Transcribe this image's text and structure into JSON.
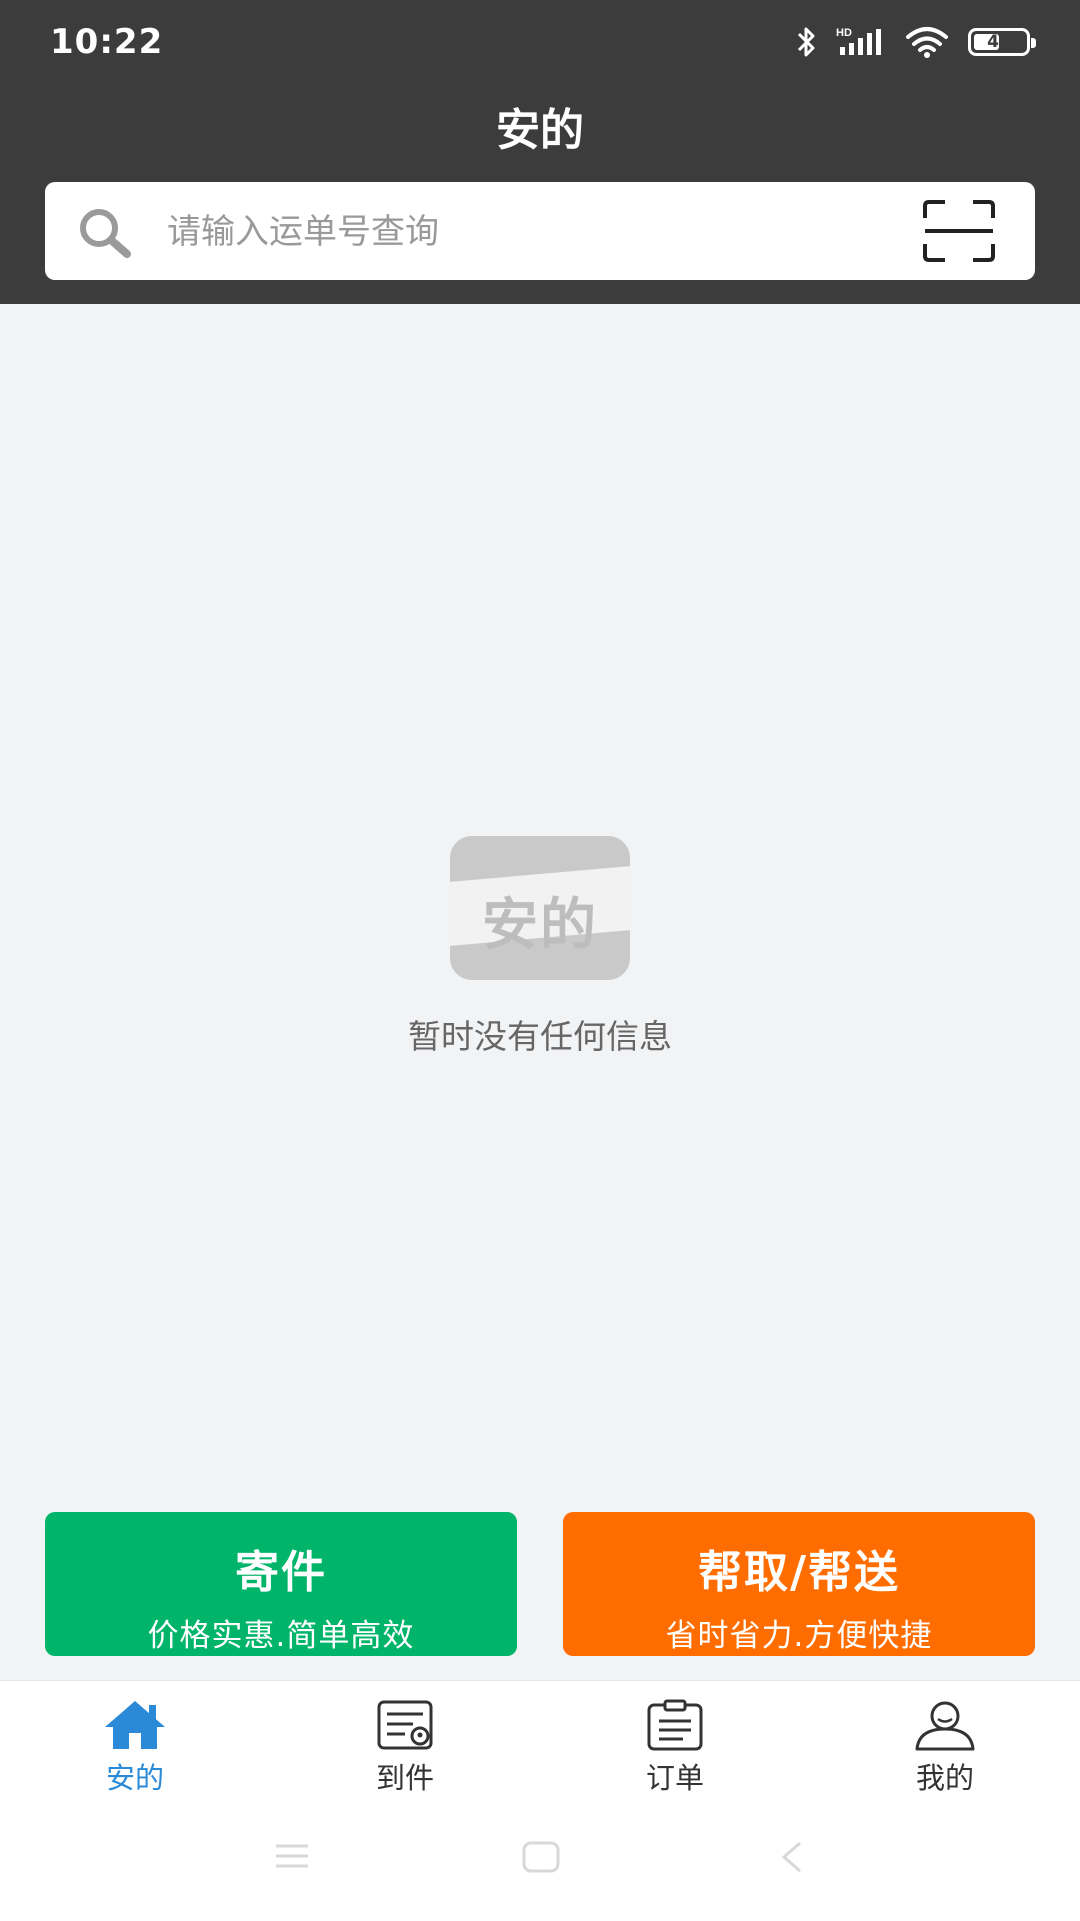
{
  "status_bar": {
    "time": "10:22",
    "battery": "47",
    "signal_label": "HD",
    "icons": [
      "bluetooth-icon",
      "signal-icon",
      "wifi-icon",
      "battery-icon"
    ]
  },
  "header": {
    "title": "安的",
    "background": "#3c3c3c"
  },
  "search": {
    "placeholder": "请输入运单号查询",
    "value": ""
  },
  "empty_state": {
    "logo_text": "安的",
    "message": "暂时没有任何信息"
  },
  "actions": {
    "send": {
      "title": "寄件",
      "subtitle": "价格实惠.简单高效",
      "color": "#00b46a"
    },
    "help": {
      "title": "帮取/帮送",
      "subtitle": "省时省力.方便快捷",
      "color": "#ff6d00"
    }
  },
  "tabbar": {
    "active_color": "#2b8ad8",
    "items": [
      {
        "label": "安的",
        "icon": "home-icon",
        "active": true
      },
      {
        "label": "到件",
        "icon": "delivery-arrival-icon",
        "active": false
      },
      {
        "label": "订单",
        "icon": "clipboard-icon",
        "active": false
      },
      {
        "label": "我的",
        "icon": "user-icon",
        "active": false
      }
    ]
  },
  "system_nav": [
    "menu-icon",
    "home-square-icon",
    "back-icon"
  ]
}
